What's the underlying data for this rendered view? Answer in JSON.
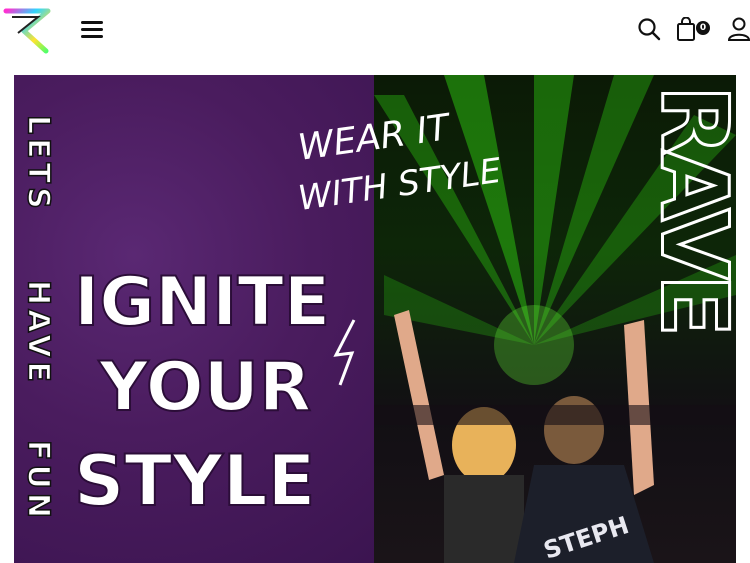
{
  "header": {
    "cart_count": "0",
    "icons": [
      "logo-icon",
      "menu-icon",
      "search-icon",
      "shopping-bag-icon",
      "user-icon"
    ]
  },
  "banner": {
    "side_text_lines": [
      "LETS",
      "HAVE",
      "FUN"
    ],
    "headline_lines": [
      "IGNITE",
      "YOUR",
      "STYLE"
    ],
    "tagline_lines": [
      "WEAR IT",
      "WITH STYLE"
    ],
    "vertical_right_text": "RAVE",
    "shirt_text": "STEPH",
    "colors": {
      "purple": "#4a1c5e",
      "laser_green": "#39ff14",
      "headline_white": "#ffffff"
    }
  }
}
